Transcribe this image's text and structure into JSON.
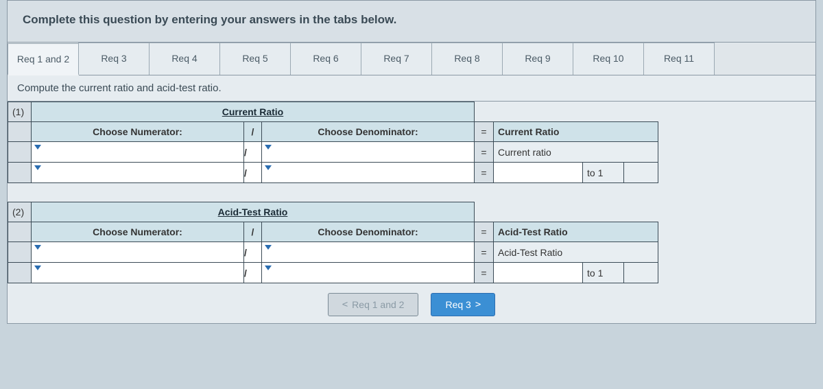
{
  "instruction": "Complete this question by entering your answers in the tabs below.",
  "tabs": [
    "Req 1 and 2",
    "Req 3",
    "Req 4",
    "Req 5",
    "Req 6",
    "Req 7",
    "Req 8",
    "Req 9",
    "Req 10",
    "Req 11"
  ],
  "activeTab": 0,
  "subhead": "Compute the current ratio and acid-test ratio.",
  "sections": [
    {
      "num": "(1)",
      "title": "Current Ratio",
      "numerator_label": "Choose Numerator:",
      "denominator_label": "Choose Denominator:",
      "result_header": "Current Ratio",
      "result_label": "Current ratio",
      "to1": "to 1"
    },
    {
      "num": "(2)",
      "title": "Acid-Test Ratio",
      "numerator_label": "Choose Numerator:",
      "denominator_label": "Choose Denominator:",
      "result_header": "Acid-Test Ratio",
      "result_label": "Acid-Test Ratio",
      "to1": "to 1"
    }
  ],
  "slash": "/",
  "equals": "=",
  "nav": {
    "prev": "Req 1 and 2",
    "next": "Req 3"
  },
  "chev": {
    "left": "<",
    "right": ">"
  }
}
